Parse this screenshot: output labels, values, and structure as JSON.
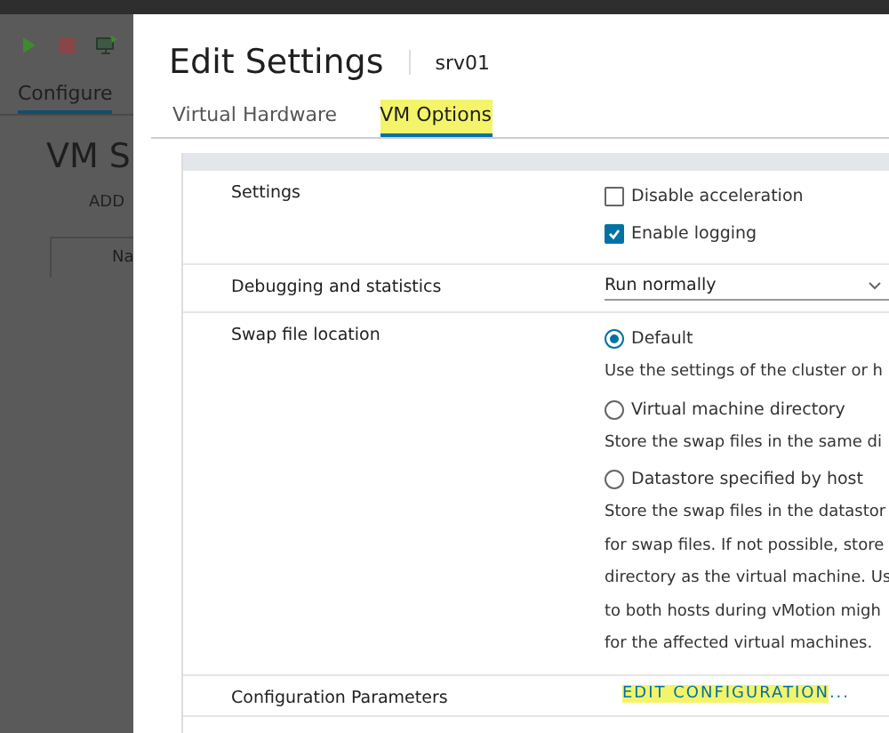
{
  "background": {
    "tabs": [
      {
        "label": "Configure",
        "selected": true
      }
    ],
    "heading": "VM S",
    "action": "ADD",
    "column_header": "Na"
  },
  "dialog": {
    "title": "Edit Settings",
    "subtitle": "srv01",
    "tabs": [
      {
        "label": "Virtual Hardware",
        "selected": false,
        "highlighted": false
      },
      {
        "label": "VM Options",
        "selected": true,
        "highlighted": true
      }
    ],
    "sections": [
      {
        "label": "Settings",
        "kind": "checkboxes",
        "options": [
          {
            "label": "Disable acceleration",
            "checked": false
          },
          {
            "label": "Enable logging",
            "checked": true
          }
        ]
      },
      {
        "label": "Debugging and statistics",
        "kind": "select",
        "value": "Run normally"
      },
      {
        "label": "Swap file location",
        "kind": "radios",
        "options": [
          {
            "label": "Default",
            "selected": true,
            "description": [
              "Use the settings of the cluster or h"
            ]
          },
          {
            "label": "Virtual machine directory",
            "selected": false,
            "description": [
              "Store the swap files in the same di"
            ]
          },
          {
            "label": "Datastore specified by host",
            "selected": false,
            "description": [
              "Store the swap files in the datastor",
              "for swap files. If not possible, store",
              "directory as the virtual machine. Us",
              "to both hosts during vMotion migh",
              "for the affected virtual machines."
            ]
          }
        ]
      },
      {
        "label": "Configuration Parameters",
        "kind": "link",
        "value": "EDIT CONFIGURATION",
        "suffix": "...",
        "highlighted": true
      }
    ]
  }
}
